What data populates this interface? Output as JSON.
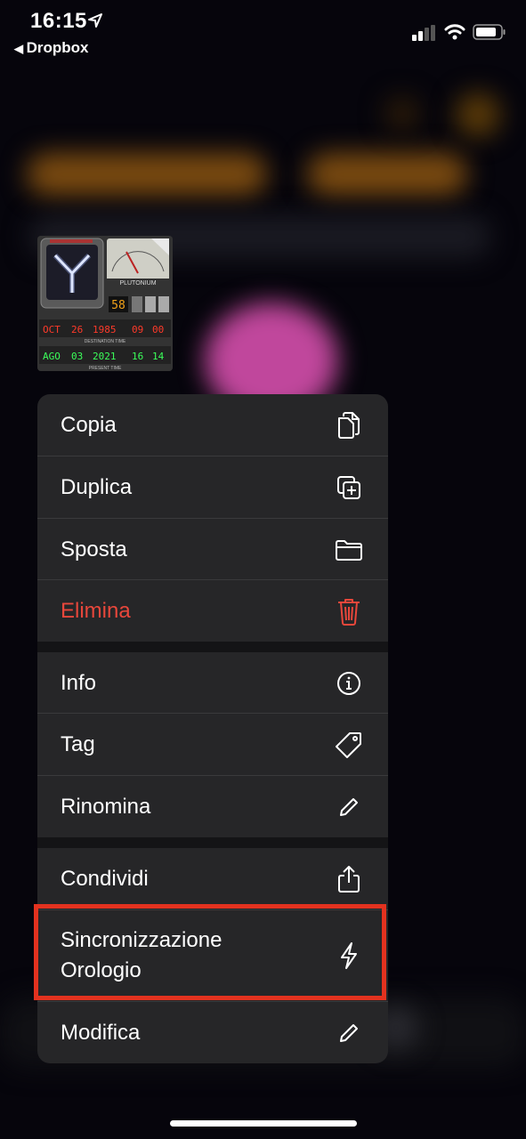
{
  "status_bar": {
    "time": "16:15",
    "back_label": "Dropbox",
    "icons": [
      "location-icon",
      "signal-icon",
      "wifi-icon",
      "battery-icon"
    ]
  },
  "thumbnail": {
    "plutonium_label": "PLUTONIUM",
    "gauge_value": "58",
    "destination_row": [
      "OCT",
      "26",
      "1985",
      "09",
      "00"
    ],
    "present_row": [
      "AGO",
      "03",
      "2021",
      "16",
      "14"
    ],
    "destination_caption": "DESTINATION TIME",
    "present_caption": "PRESENT TIME"
  },
  "menu": {
    "items": [
      {
        "label": "Copia",
        "icon": "copy-icon"
      },
      {
        "label": "Duplica",
        "icon": "duplicate-icon"
      },
      {
        "label": "Sposta",
        "icon": "folder-icon"
      },
      {
        "label": "Elimina",
        "icon": "trash-icon",
        "color": "#e8473b"
      },
      {
        "label": "Info",
        "icon": "info-icon"
      },
      {
        "label": "Tag",
        "icon": "tag-icon"
      },
      {
        "label": "Rinomina",
        "icon": "pencil-icon"
      },
      {
        "label": "Condividi",
        "icon": "share-icon"
      },
      {
        "label": "Sincronizzazione\nOrologio",
        "line1": "Sincronizzazione",
        "line2": "Orologio",
        "icon": "bolt-icon"
      },
      {
        "label": "Modifica",
        "icon": "pencil-icon"
      }
    ]
  },
  "colors": {
    "menu_bg": "#262628",
    "destructive": "#e8473b",
    "highlight_border": "#e3321f",
    "accent_blur": "#d98a1e"
  }
}
